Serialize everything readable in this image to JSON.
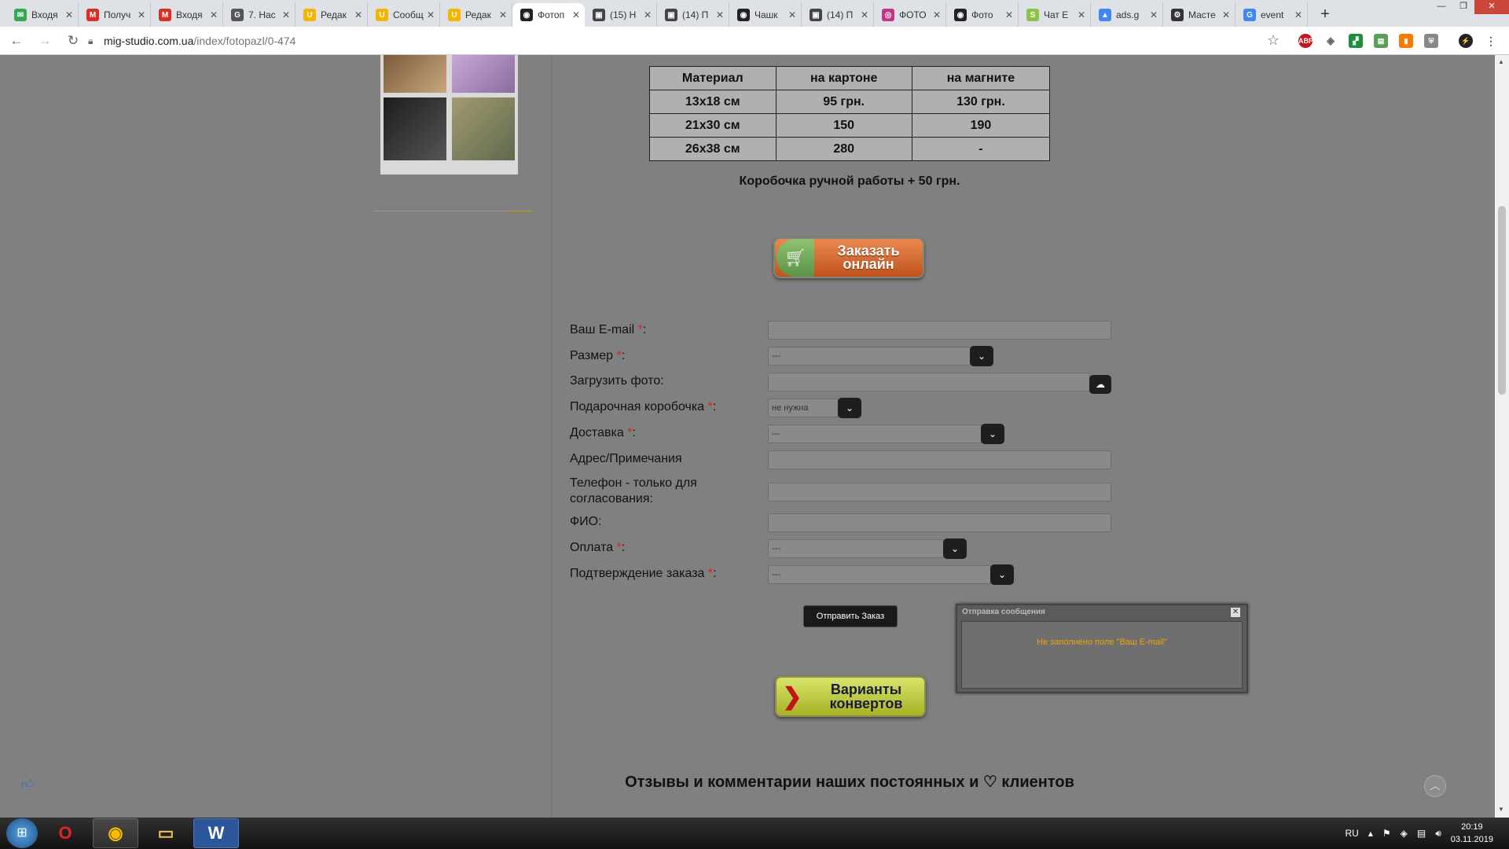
{
  "browser": {
    "tabs": [
      {
        "label": "Входя",
        "icon": "mail-icon",
        "color": "#34a853",
        "glyph": "✉"
      },
      {
        "label": "Получ",
        "icon": "gmail-icon",
        "color": "#d93025",
        "glyph": "M"
      },
      {
        "label": "Входя",
        "icon": "gmail-icon",
        "color": "#d93025",
        "glyph": "M"
      },
      {
        "label": "7. Нас",
        "icon": "site-icon",
        "color": "#555555",
        "glyph": "G"
      },
      {
        "label": "Редак",
        "icon": "ucoz-icon",
        "color": "#f4b400",
        "glyph": "U"
      },
      {
        "label": "Сообщ",
        "icon": "ucoz-icon",
        "color": "#f4b400",
        "glyph": "U"
      },
      {
        "label": "Редак",
        "icon": "ucoz-icon",
        "color": "#f4b400",
        "glyph": "U"
      },
      {
        "label": "Фотоп",
        "icon": "site-icon",
        "color": "#222222",
        "glyph": "◉",
        "active": true
      },
      {
        "label": "(15) Н",
        "icon": "page-icon",
        "color": "#444444",
        "glyph": "▣"
      },
      {
        "label": "(14) П",
        "icon": "page-icon",
        "color": "#444444",
        "glyph": "▣"
      },
      {
        "label": "Чашк",
        "icon": "site-icon",
        "color": "#222222",
        "glyph": "◉"
      },
      {
        "label": "(14) П",
        "icon": "page-icon",
        "color": "#444444",
        "glyph": "▣"
      },
      {
        "label": "ФОТО",
        "icon": "instagram-icon",
        "color": "#c13584",
        "glyph": "◎"
      },
      {
        "label": "Фото",
        "icon": "site-icon",
        "color": "#222222",
        "glyph": "◉"
      },
      {
        "label": "Чат Е",
        "icon": "chat-icon",
        "color": "#8bc34a",
        "glyph": "S"
      },
      {
        "label": "ads.g",
        "icon": "google-ads-icon",
        "color": "#4285f4",
        "glyph": "▲"
      },
      {
        "label": "Масте",
        "icon": "gear-icon",
        "color": "#333333",
        "glyph": "⚙"
      },
      {
        "label": "event",
        "icon": "google-icon",
        "color": "#4285f4",
        "glyph": "G"
      }
    ],
    "url_host": "mig-studio.com.ua",
    "url_path": "/index/fotopazl/0-474"
  },
  "price_table": {
    "headers": [
      "Материал",
      "на картоне",
      "на магните"
    ],
    "rows": [
      [
        "13x18 см",
        "95 грн.",
        "130 грн."
      ],
      [
        "21x30 см",
        "150",
        "190"
      ],
      [
        "26x38 см",
        "280",
        "-"
      ]
    ]
  },
  "box_note": "Коробочка ручной работы + 50 грн.",
  "order_button": {
    "line1": "Заказать",
    "line2": "онлайн"
  },
  "form": {
    "required_mark": "*",
    "email_label": "Ваш E-mail",
    "size_label": "Размер",
    "size_value": "---",
    "upload_label": "Загрузить фото:",
    "giftbox_label": "Подарочная коробочка",
    "giftbox_value": "не нужна",
    "delivery_label": "Доставка",
    "delivery_value": "---",
    "address_label": "Адрес/Примечания",
    "phone_label_line1": "Телефон - только для",
    "phone_label_line2": "согласования:",
    "name_label": "ФИО:",
    "payment_label": "Оплата",
    "payment_value": "---",
    "confirm_label": "Подтверждение заказа",
    "confirm_value": "---",
    "submit_label": "Отправить Заказ"
  },
  "dialog": {
    "title": "Отправка сообщения",
    "message": "Не заполнено поле \"Ваш E-mail\""
  },
  "envelopes_button": {
    "line1": "Варианты",
    "line2": "конвертов"
  },
  "reviews_heading": "Отзывы и комментарии наших постоянных и ♡ клиентов",
  "taskbar": {
    "lang": "RU",
    "time": "20:19",
    "date": "03.11.2019"
  }
}
